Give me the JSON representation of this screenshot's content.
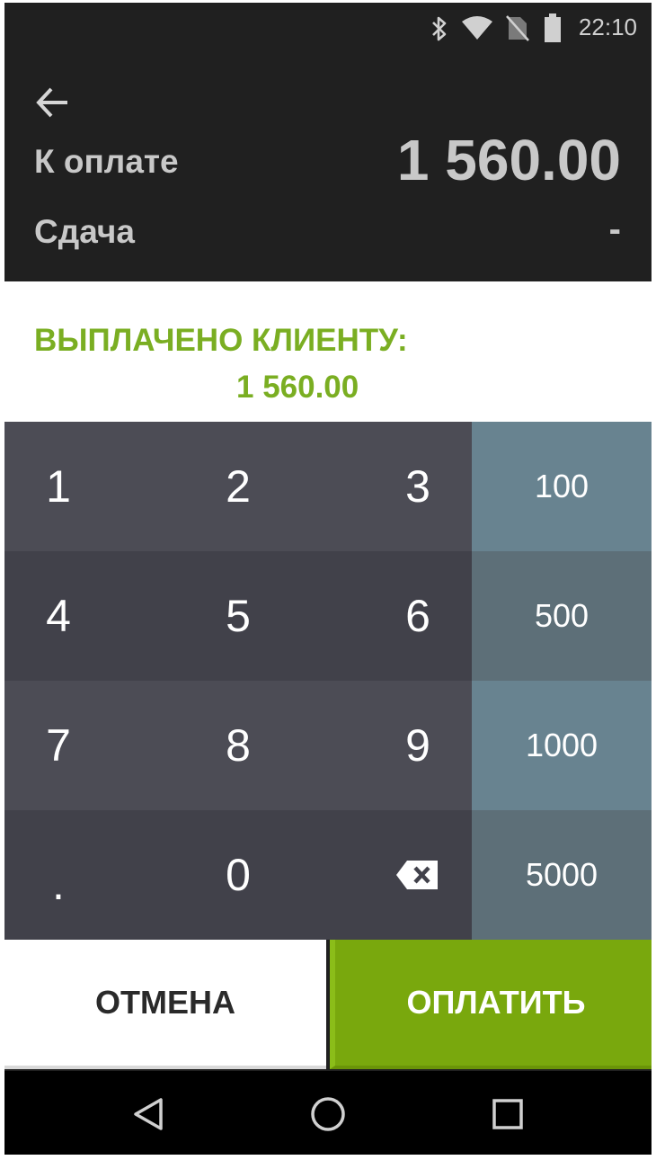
{
  "status_bar": {
    "time": "22:10",
    "icons": [
      "bluetooth-icon",
      "wifi-icon",
      "no-sim-icon",
      "battery-icon"
    ]
  },
  "header": {
    "back_icon": "arrow-left-icon",
    "due_label": "К оплате",
    "due_amount": "1 560.00",
    "change_label": "Сдача",
    "change_value": "-"
  },
  "paid": {
    "label": "ВЫПЛАЧЕНО КЛИЕНТУ:",
    "amount": "1 560.00"
  },
  "keypad": {
    "digits": [
      "1",
      "2",
      "3",
      "4",
      "5",
      "6",
      "7",
      "8",
      "9",
      ".",
      "0"
    ],
    "backspace_icon": "backspace-icon",
    "quick_amounts": [
      "100",
      "500",
      "1000",
      "5000"
    ]
  },
  "actions": {
    "cancel_label": "ОТМЕНА",
    "pay_label": "ОПЛАТИТЬ"
  },
  "nav_bar": {
    "icons": [
      "back-triangle-icon",
      "home-circle-icon",
      "recents-square-icon"
    ]
  },
  "colors": {
    "accent_green": "#79a80d",
    "paid_text_green": "#7aae22",
    "header_bg": "#202020",
    "keypad_dark": "#41414a",
    "keypad_light": "#4c4c55",
    "quick_light": "#688390",
    "quick_dark": "#5d6f78"
  }
}
